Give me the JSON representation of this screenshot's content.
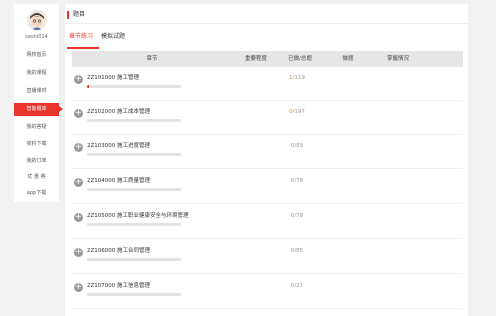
{
  "sidebar": {
    "username": "ceshi014",
    "items": [
      {
        "label": "网校首页",
        "active": false
      },
      {
        "label": "我的课程",
        "active": false
      },
      {
        "label": "直播课时",
        "active": false
      },
      {
        "label": "智能题库",
        "active": true
      },
      {
        "label": "我的答疑",
        "active": false
      },
      {
        "label": "资料下载",
        "active": false
      },
      {
        "label": "我的订单",
        "active": false
      },
      {
        "label": "优 惠 券",
        "active": false
      },
      {
        "label": "app下载",
        "active": false
      }
    ]
  },
  "header": {
    "title": "题目"
  },
  "tabs": [
    {
      "label": "章节练习",
      "active": true
    },
    {
      "label": "模拟试题",
      "active": false
    }
  ],
  "table": {
    "columns": [
      "章节",
      "重要程度",
      "已做/总题",
      "做题",
      "掌握情况"
    ],
    "rows": [
      {
        "title": "2Z101000 施工管理",
        "done": "1",
        "total": "/119",
        "progress": 0.01
      },
      {
        "title": "2Z102000 施工成本管理",
        "done": "0",
        "total": "/197",
        "progress": 0
      },
      {
        "title": "2Z103000 施工进度管理",
        "done": "0",
        "total": "/89",
        "progress": 0
      },
      {
        "title": "2Z104000 施工质量管理",
        "done": "0",
        "total": "/78",
        "progress": 0
      },
      {
        "title": "2Z105000 施工职业健康安全与环境管理",
        "done": "0",
        "total": "/78",
        "progress": 0
      },
      {
        "title": "2Z106000 施工合同管理",
        "done": "0",
        "total": "/85",
        "progress": 0
      },
      {
        "title": "2Z107000 施工信息管理",
        "done": "0",
        "total": "/21",
        "progress": 0
      }
    ]
  },
  "colors": {
    "accent": "#e8352c",
    "done": "#f08a24"
  }
}
